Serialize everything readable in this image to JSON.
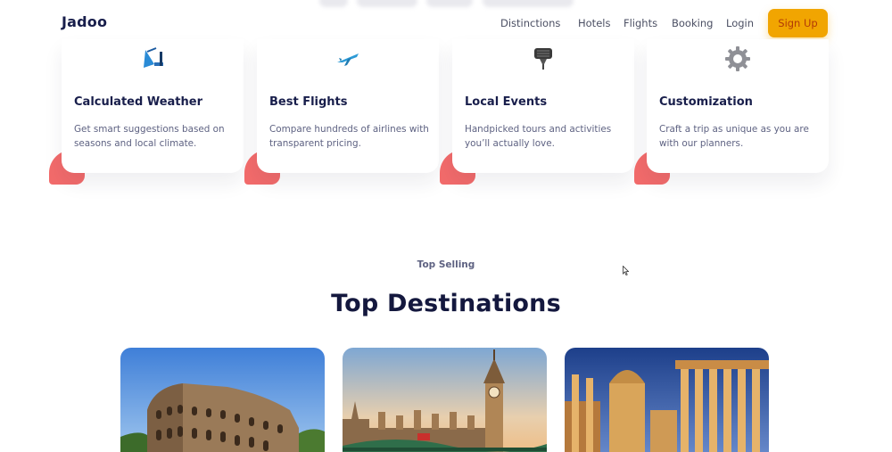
{
  "header": {
    "logo": "Jadoo",
    "nav": [
      "Distinctions",
      "Hotels",
      "Flights",
      "Booking",
      "Login"
    ],
    "signup": "Sign Up"
  },
  "services": [
    {
      "icon": "satellite-dish-icon",
      "title": "Calculated Weather",
      "desc": "Get smart suggestions based on seasons and local climate."
    },
    {
      "icon": "airplane-icon",
      "title": "Best Flights",
      "desc": "Compare hundreds of airlines with transparent pricing."
    },
    {
      "icon": "microphone-icon",
      "title": "Local Events",
      "desc": "Handpicked tours and activities you’ll actually love."
    },
    {
      "icon": "gear-icon",
      "title": "Customization",
      "desc": "Craft a trip as unique as you are with our planners."
    }
  ],
  "section": {
    "subtitle": "Top Selling",
    "title": "Top Destinations"
  },
  "destinations": [
    {
      "image": "colosseum-photo"
    },
    {
      "image": "big-ben-photo"
    },
    {
      "image": "roman-forum-photo"
    }
  ],
  "colors": {
    "accent": "#f1a501",
    "coral": "#f26b6b",
    "navy": "#181e4b",
    "muted": "#5e6282"
  }
}
